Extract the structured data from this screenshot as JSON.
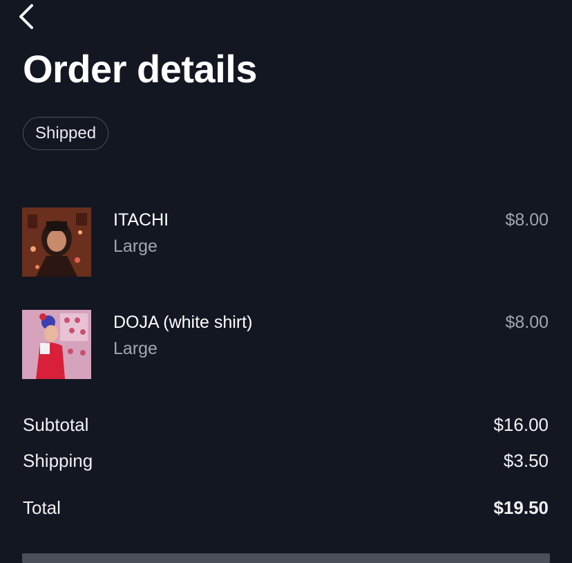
{
  "header": {
    "back_icon": "chevron-left-icon",
    "title": "Order details"
  },
  "status": {
    "label": "Shipped"
  },
  "items": [
    {
      "name": "ITACHI",
      "variant": "Large",
      "price": "$8.00"
    },
    {
      "name": "DOJA (white shirt)",
      "variant": "Large",
      "price": "$8.00"
    }
  ],
  "summary": {
    "subtotal_label": "Subtotal",
    "subtotal_value": "$16.00",
    "shipping_label": "Shipping",
    "shipping_value": "$3.50",
    "total_label": "Total",
    "total_value": "$19.50"
  },
  "colors": {
    "background": "#131722",
    "muted_text": "#a2a6b0",
    "badge_border": "#4a505c"
  }
}
